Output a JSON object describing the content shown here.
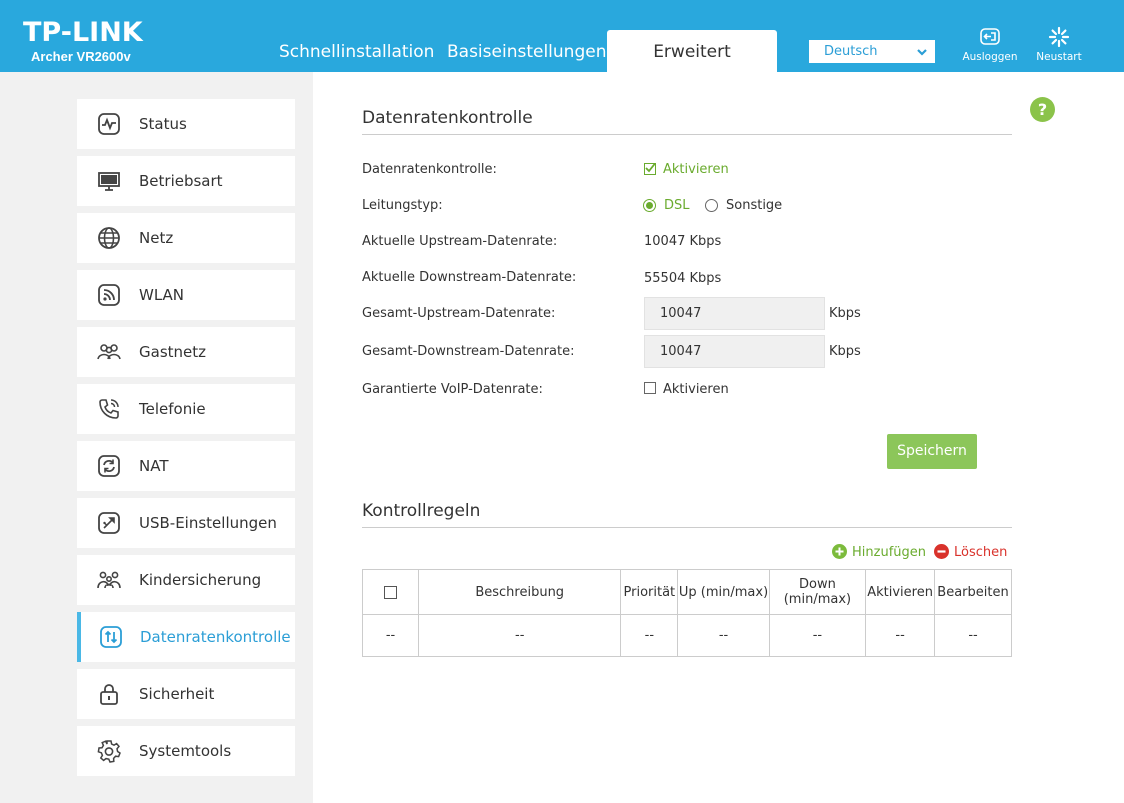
{
  "header": {
    "logo": "TP-LINK",
    "model": "Archer VR2600v",
    "tabs": [
      {
        "label": "Schnellinstallation"
      },
      {
        "label": "Basiseinstellungen"
      },
      {
        "label": "Erweitert",
        "active": true
      }
    ],
    "language": "Deutsch",
    "logout_label": "Ausloggen",
    "restart_label": "Neustart",
    "accent_color": "#29a8dd"
  },
  "sidebar": {
    "items": [
      {
        "label": "Status",
        "icon": "pulse-icon"
      },
      {
        "label": "Betriebsart",
        "icon": "monitor-icon"
      },
      {
        "label": "Netz",
        "icon": "globe-icon"
      },
      {
        "label": "WLAN",
        "icon": "wifi-icon"
      },
      {
        "label": "Gastnetz",
        "icon": "guests-icon"
      },
      {
        "label": "Telefonie",
        "icon": "phone-icon"
      },
      {
        "label": "NAT",
        "icon": "nat-icon"
      },
      {
        "label": "USB-Einstellungen",
        "icon": "usb-icon"
      },
      {
        "label": "Kindersicherung",
        "icon": "family-icon"
      },
      {
        "label": "Datenratenkontrolle",
        "icon": "updown-icon",
        "active": true
      },
      {
        "label": "Sicherheit",
        "icon": "lock-icon"
      },
      {
        "label": "Systemtools",
        "icon": "gear-icon"
      }
    ]
  },
  "main": {
    "help": "?",
    "section1_title": "Datenratenkontrolle",
    "fields": {
      "control_label": "Datenratenkontrolle:",
      "control_value": "Aktivieren",
      "control_checked": true,
      "line_type_label": "Leitungstyp:",
      "line_type_options": [
        "DSL",
        "Sonstige"
      ],
      "line_type_selected": "DSL",
      "cur_up_label": "Aktuelle Upstream-Datenrate:",
      "cur_up_value": "10047 Kbps",
      "cur_down_label": "Aktuelle Downstream-Datenrate:",
      "cur_down_value": "55504 Kbps",
      "total_up_label": "Gesamt-Upstream-Datenrate:",
      "total_up_value": "10047",
      "total_up_unit": "Kbps",
      "total_down_label": "Gesamt-Downstream-Datenrate:",
      "total_down_value": "10047",
      "total_down_unit": "Kbps",
      "voip_label": "Garantierte VoIP-Datenrate:",
      "voip_value": "Aktivieren",
      "voip_checked": false
    },
    "save_label": "Speichern",
    "section2_title": "Kontrollregeln",
    "add_label": "Hinzufügen",
    "delete_label": "Löschen",
    "table": {
      "headers": [
        "",
        "Beschreibung",
        "Priorität",
        "Up (min/max)",
        "Down (min/max)",
        "Aktivieren",
        "Bearbeiten"
      ],
      "rows": [
        [
          "--",
          "--",
          "--",
          "--",
          "--",
          "--",
          "--"
        ]
      ]
    }
  }
}
